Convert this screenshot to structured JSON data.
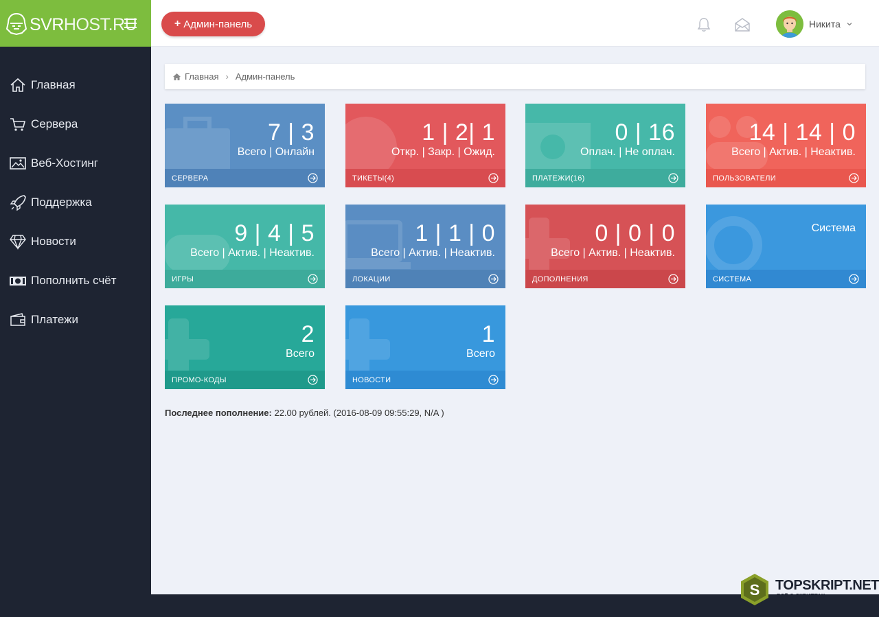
{
  "brand": {
    "logo_main": "SVR",
    "logo_rest": "HOST.RU"
  },
  "sidebar": {
    "items": [
      {
        "label": "Главная",
        "icon": "home-icon"
      },
      {
        "label": "Сервера",
        "icon": "cart-icon"
      },
      {
        "label": "Веб-Хостинг",
        "icon": "image-icon"
      },
      {
        "label": "Поддержка",
        "icon": "rocket-icon"
      },
      {
        "label": "Новости",
        "icon": "diamond-icon"
      },
      {
        "label": "Пополнить счёт",
        "icon": "money-icon"
      },
      {
        "label": "Платежи",
        "icon": "wallet-icon"
      }
    ]
  },
  "topbar": {
    "admin_button": "Админ-панель",
    "admin_button_plus": "+",
    "user_name": "Никита"
  },
  "breadcrumb": {
    "home": "Главная",
    "current": "Админ-панель"
  },
  "cards": [
    {
      "value": "7 | 3",
      "subtitle": "Всего | Онлайн",
      "footer": "СЕРВЕРА"
    },
    {
      "value": "1 | 2| 1",
      "subtitle": "Откр. | Закр. | Ожид.",
      "footer": "ТИКЕТЫ(4)"
    },
    {
      "value": "0 | 16",
      "subtitle": "Оплач. | Не оплач.",
      "footer": "ПЛАТЕЖИ(16)"
    },
    {
      "value": "14 | 14 | 0",
      "subtitle": "Всего | Актив. | Неактив.",
      "footer": "ПОЛЬЗОВАТЕЛИ"
    },
    {
      "value": "9 | 4 | 5",
      "subtitle": "Всего | Актив. | Неактив.",
      "footer": "ИГРЫ"
    },
    {
      "value": "1 | 1 | 0",
      "subtitle": "Всего | Актив. | Неактив.",
      "footer": "ЛОКАЦИИ"
    },
    {
      "value": "0 | 0 | 0",
      "subtitle": "Всего | Актив. | Неактив.",
      "footer": "ДОПОЛНЕНИЯ"
    },
    {
      "title": "Система",
      "footer": "СИСТЕМА"
    },
    {
      "value": "2",
      "subtitle": "Всего",
      "footer": "ПРОМО-КОДЫ"
    },
    {
      "value": "1",
      "subtitle": "Всего",
      "footer": "НОВОСТИ"
    }
  ],
  "last_topup": {
    "label": "Последнее пополнение:",
    "value": "22.00 рублей. (2016-08-09 09:55:29, N/A )"
  },
  "watermark": {
    "text": "TOPSKRIPT.NET",
    "sub": "ВСЁ О СКРИПТАХ",
    "letter": "S"
  }
}
